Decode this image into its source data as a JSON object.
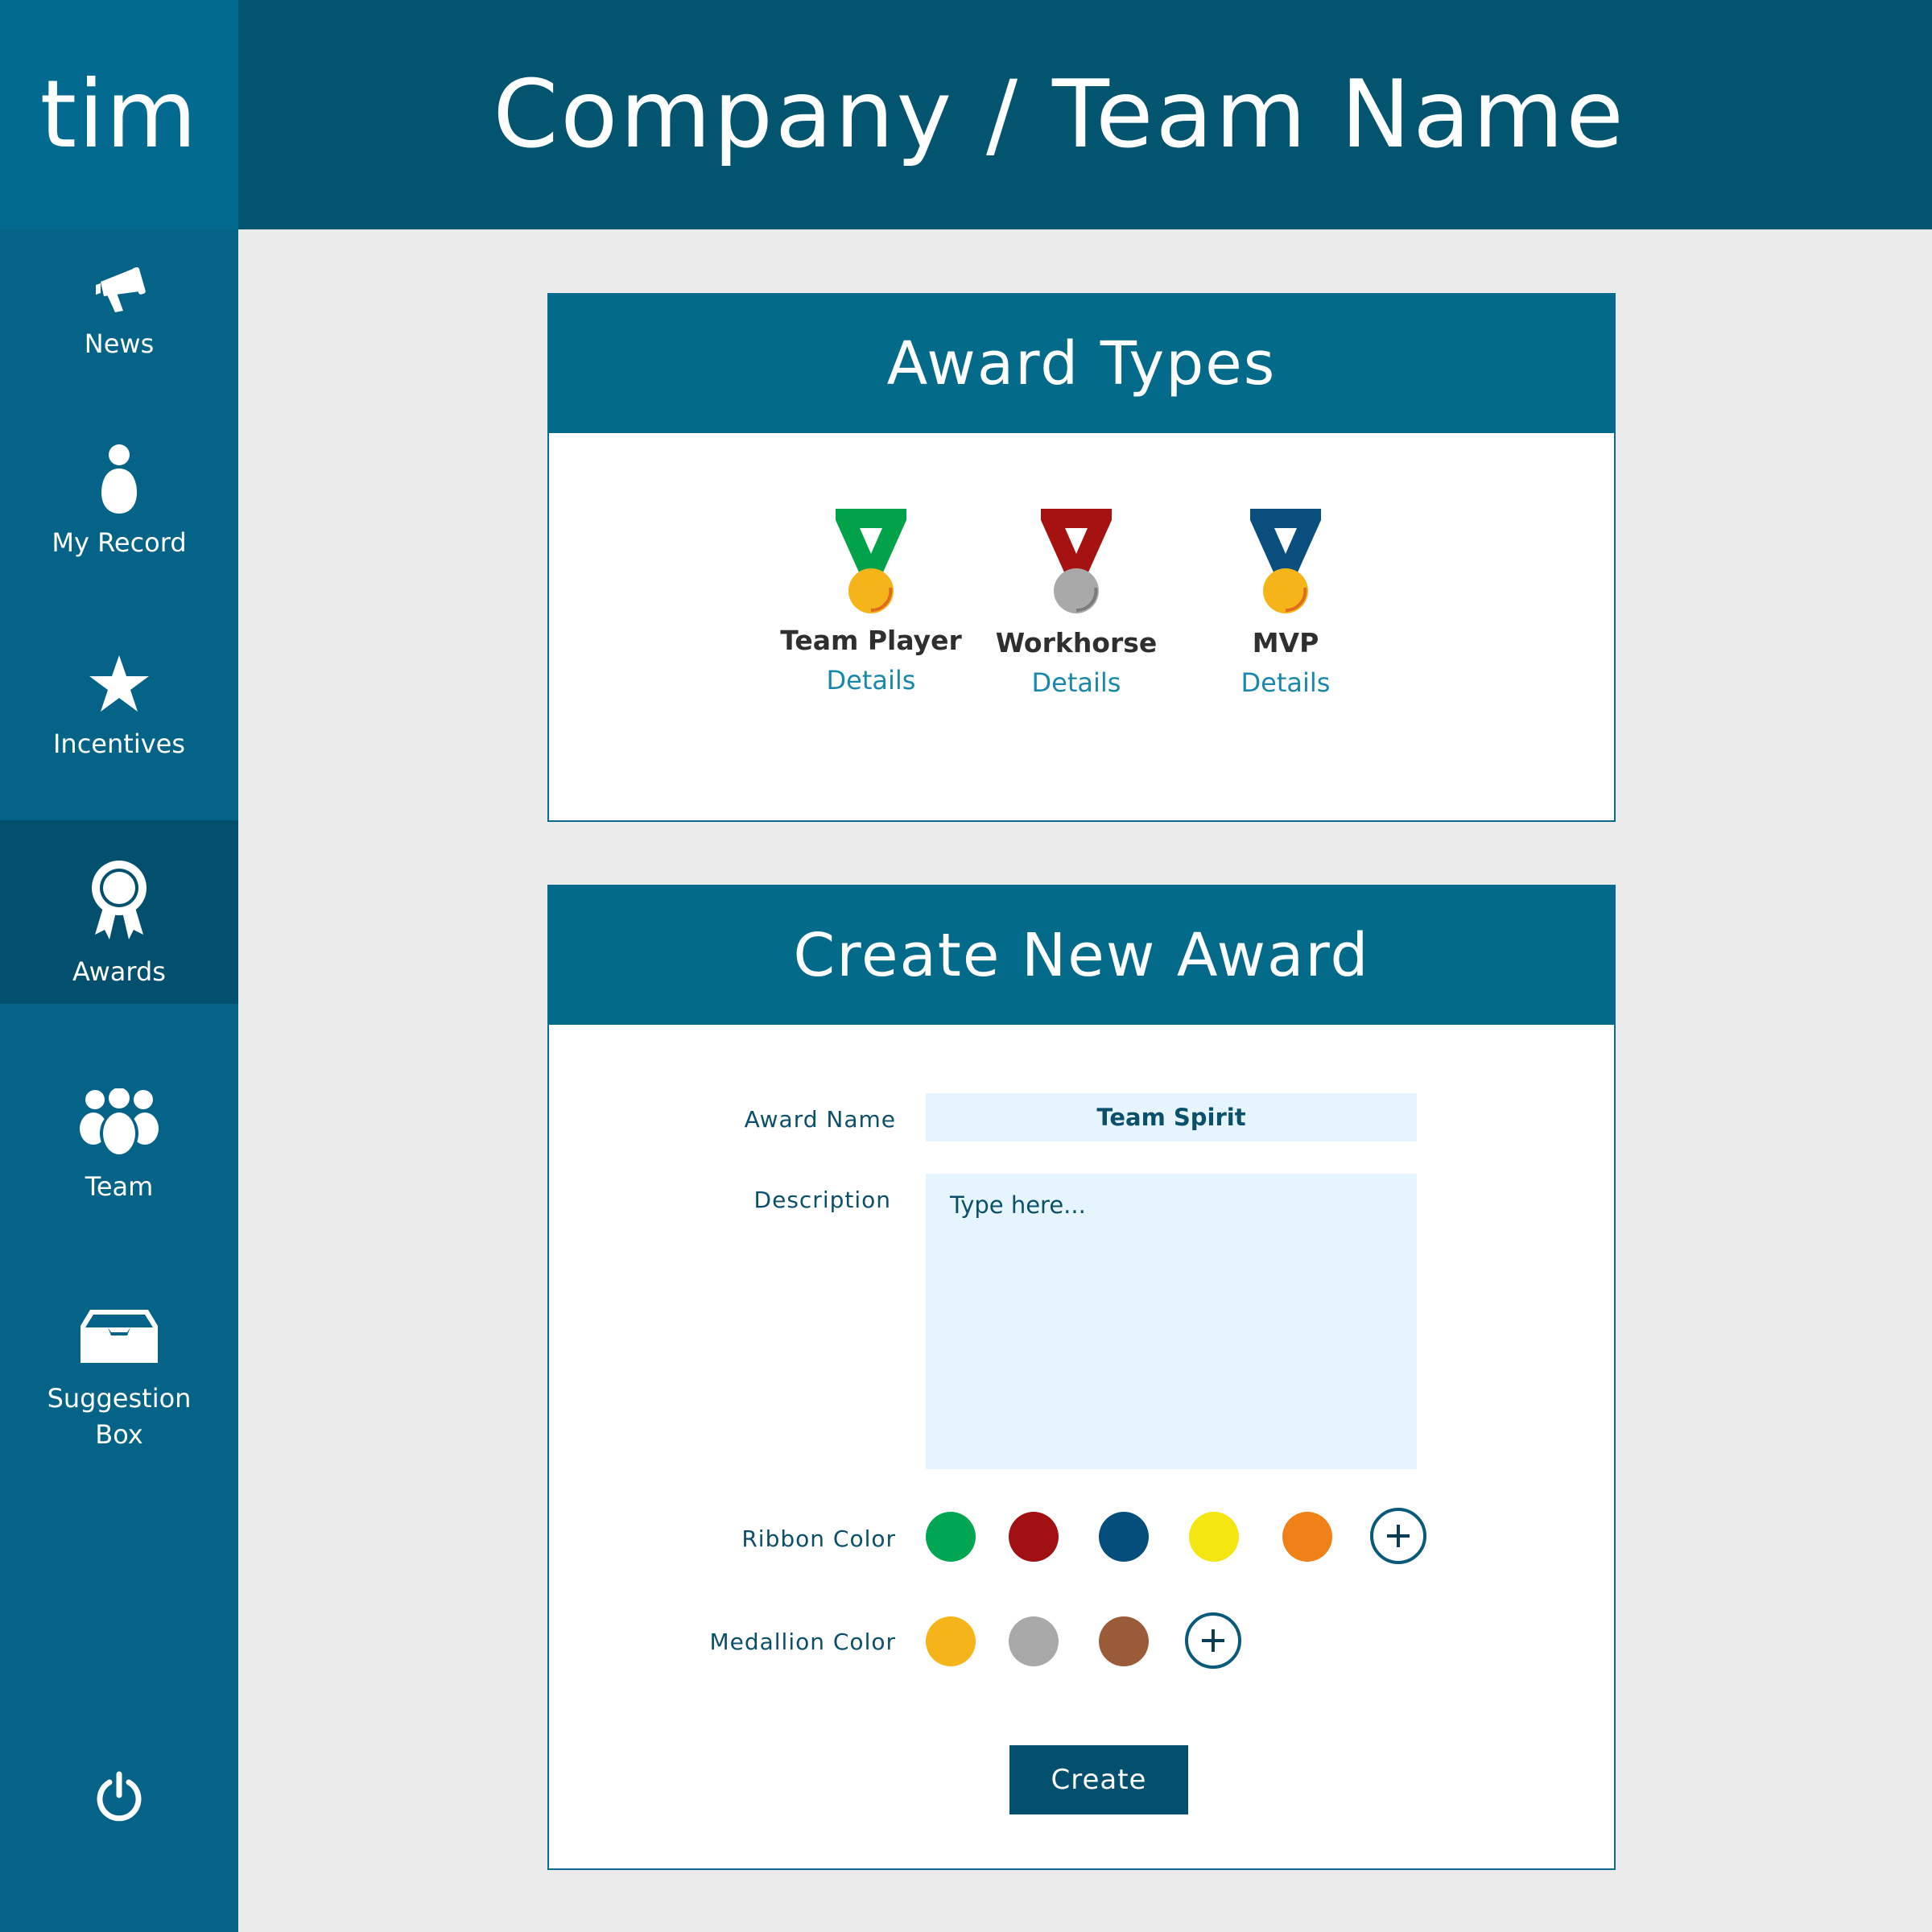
{
  "app": {
    "brand": "tim"
  },
  "header": {
    "title": "Company / Team Name"
  },
  "sidebar": {
    "items": [
      {
        "label": "News",
        "icon": "megaphone-icon"
      },
      {
        "label": "My Record",
        "icon": "person-icon"
      },
      {
        "label": "Incentives",
        "icon": "star-icon"
      },
      {
        "label": "Awards",
        "icon": "award-ribbon-icon",
        "active": true
      },
      {
        "label": "Team",
        "icon": "group-icon"
      },
      {
        "label": "Suggestion",
        "label_line2": "Box",
        "icon": "inbox-tray-icon"
      }
    ],
    "power_icon": "power-icon"
  },
  "award_types": {
    "title": "Award Types",
    "awards": [
      {
        "name": "Team Player",
        "link": "Details",
        "ribbon_color": "#02a24a",
        "medal_color": "#f5b51a"
      },
      {
        "name": "Workhorse",
        "link": "Details",
        "ribbon_color": "#a41212",
        "medal_color": "#a9a9a9"
      },
      {
        "name": "MVP",
        "link": "Details",
        "ribbon_color": "#0a4e7e",
        "medal_color": "#f5b51a"
      }
    ]
  },
  "create_award": {
    "title": "Create New Award",
    "award_name_label": "Award Name",
    "award_name_value": "Team Spirit",
    "description_label": "Description",
    "description_placeholder": "Type here...",
    "ribbon_color_label": "Ribbon Color",
    "ribbon_colors": [
      "#00a651",
      "#a11013",
      "#054e7c",
      "#f3e611",
      "#f08119"
    ],
    "medallion_color_label": "Medallion Color",
    "medallion_colors": [
      "#f5b51a",
      "#a9a9a9",
      "#9a5c38"
    ],
    "add_icon": "plus-icon",
    "create_button": "Create"
  }
}
